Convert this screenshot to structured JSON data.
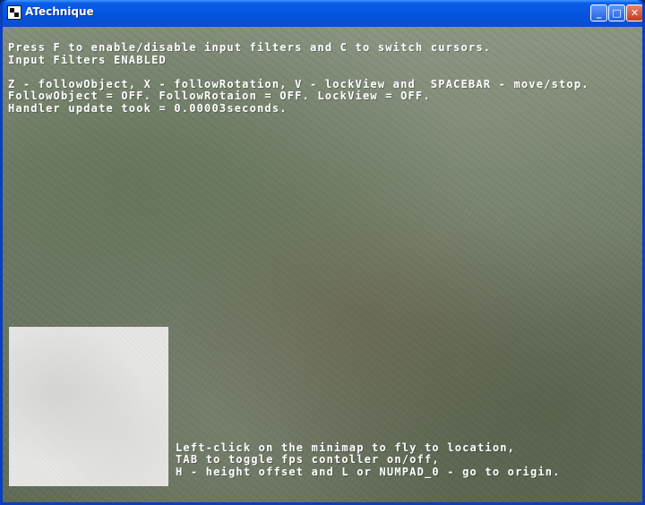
{
  "window": {
    "title": "ATechnique",
    "minimize_label": "_",
    "maximize_label": "□",
    "close_label": "✕"
  },
  "hud": {
    "line1": "Press F to enable/disable input filters and C to switch cursors.",
    "line2": "Input Filters ENABLED",
    "line3": "Z - followObject, X - followRotation, V - lockView and  SPACEBAR - move/stop.",
    "line4": "FollowObject = OFF. FollowRotaion = OFF. LockView = OFF.",
    "line5": "Handler update took = 0.00003seconds."
  },
  "help": {
    "line1": "Left-click on the minimap to fly to location,",
    "line2": "TAB to toggle fps contoller on/off,",
    "line3": "H - height offset and L or NUMPAD_0 - go to origin."
  },
  "icons": {
    "app": "app-icon",
    "minimize": "minimize-icon",
    "maximize": "maximize-icon",
    "close": "close-icon"
  }
}
